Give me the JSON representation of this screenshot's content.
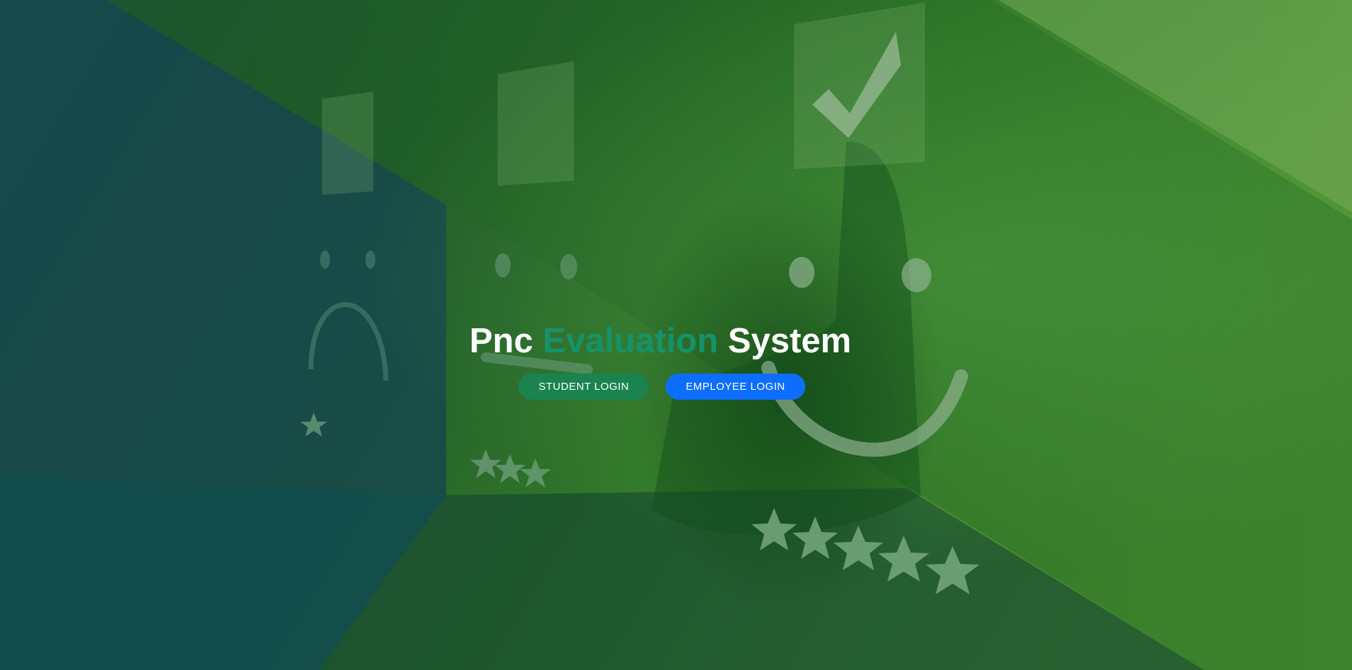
{
  "hero": {
    "title_part1": "Pnc",
    "title_accent": "Evaluation",
    "title_part2": "System"
  },
  "buttons": {
    "student_login": "STUDENT LOGIN",
    "employee_login": "EMPLOYEE LOGIN"
  },
  "colors": {
    "title_accent": "#16926a",
    "student_button": "#1a8350",
    "employee_button": "#0d6efd",
    "background_green": "#2a6e2a",
    "background_teal": "#14505a"
  },
  "background": {
    "description_icons": [
      "sad-face-icon",
      "neutral-face-icon",
      "happy-face-icon",
      "checkmark-icon",
      "star-icon"
    ]
  }
}
